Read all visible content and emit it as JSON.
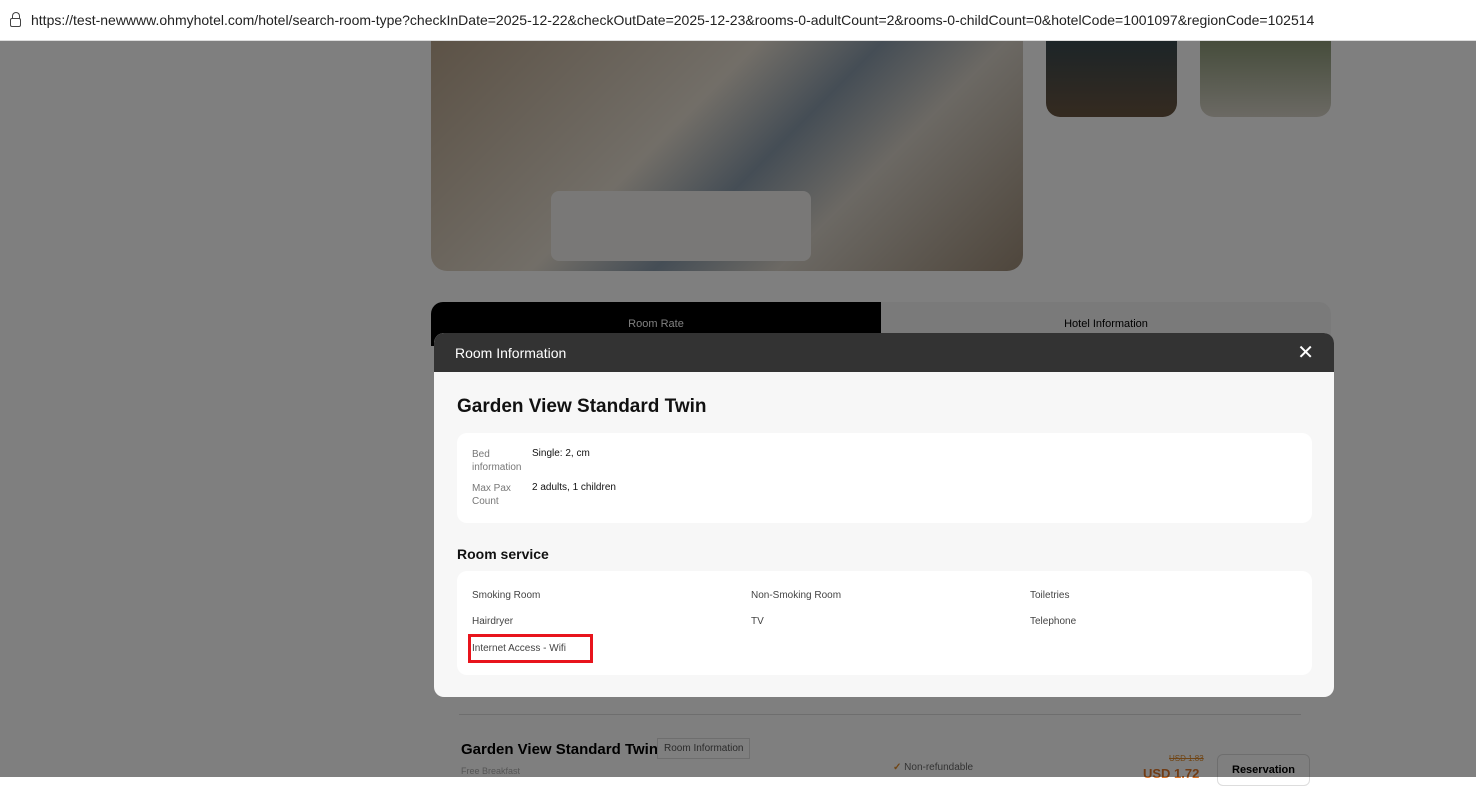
{
  "browser": {
    "url": "https://test-newwww.ohmyhotel.com/hotel/search-room-type?checkInDate=2025-12-22&checkOutDate=2025-12-23&rooms-0-adultCount=2&rooms-0-childCount=0&hotelCode=1001097&regionCode=102514"
  },
  "tabs": [
    "Room Rate",
    "Hotel Information"
  ],
  "background_room": {
    "name": "Garden View Standard Twin",
    "info_button": "Room Information",
    "sub": "Free Breakfast",
    "policy": "Non-refundable",
    "old_price": "USD 1.83",
    "price": "USD 1.72",
    "reserve": "Reservation"
  },
  "modal": {
    "header": "Room Information",
    "close": "✕",
    "room_name": "Garden View Standard Twin",
    "details": [
      {
        "label": "Bed information",
        "value": "Single: 2, cm"
      },
      {
        "label": "Max Pax Count",
        "value": "2 adults, 1 children"
      }
    ],
    "service_title": "Room service",
    "services": [
      "Smoking Room",
      "Non-Smoking Room",
      "Toiletries",
      "Hairdryer",
      "TV",
      "Telephone",
      "Internet Access - Wifi"
    ]
  },
  "colors": {
    "highlight": "#e8141c",
    "header": "#333333"
  }
}
